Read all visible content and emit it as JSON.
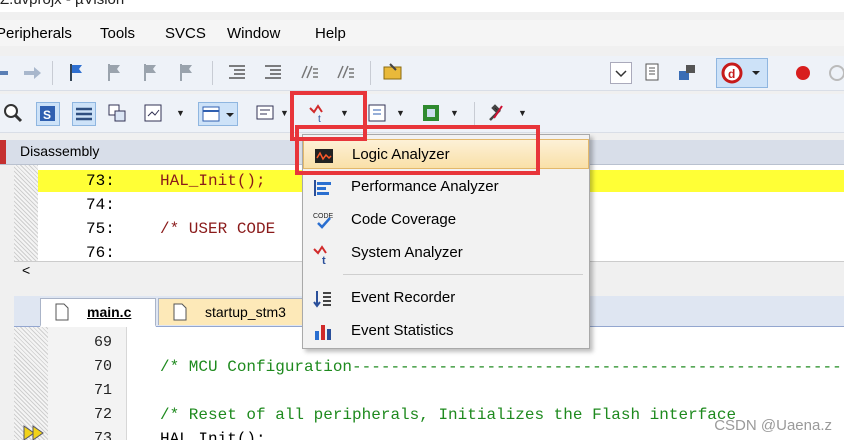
{
  "window": {
    "title": "Z.uvprojx - µVision"
  },
  "menubar": {
    "items": [
      "Peripherals",
      "Tools",
      "SVCS",
      "Window",
      "Help"
    ]
  },
  "disassembly": {
    "tab_label": "Disassembly",
    "lines": [
      {
        "num": "73:",
        "code": "HAL_Init();"
      },
      {
        "num": "74:",
        "code": ""
      },
      {
        "num": "75:",
        "code": "/* USER CODE"
      },
      {
        "num": "76:",
        "code": ""
      }
    ],
    "scroll_left_glyph": "<"
  },
  "editor": {
    "tabs": [
      {
        "label": "main.c",
        "active": true
      },
      {
        "label": "startup_stm3",
        "active": false
      }
    ],
    "lines": [
      {
        "num": "69",
        "code": ""
      },
      {
        "num": "70",
        "code": "/* MCU Configuration------------------------------------------------------------"
      },
      {
        "num": "71",
        "code": ""
      },
      {
        "num": "72",
        "code": "/* Reset of all peripherals, Initializes the Flash interface"
      },
      {
        "num": "73",
        "code": "HAL_Init();"
      }
    ]
  },
  "analysis_menu": {
    "items": [
      {
        "label": "Logic Analyzer",
        "icon": "logic-analyzer-icon",
        "highlighted": true
      },
      {
        "label": "Performance Analyzer",
        "icon": "performance-analyzer-icon"
      },
      {
        "label": "Code Coverage",
        "icon": "code-coverage-icon",
        "icon_text": "CODE"
      },
      {
        "label": "System Analyzer",
        "icon": "system-analyzer-icon"
      },
      {
        "label": "Event Recorder",
        "icon": "event-recorder-icon"
      },
      {
        "label": "Event Statistics",
        "icon": "event-statistics-icon"
      }
    ]
  },
  "watermark": "CSDN @Uaena.z",
  "colors": {
    "highlight_line": "#ffff36",
    "annotation_red": "#e8353a",
    "menu_hover": "#f9e0a8",
    "comment_green": "#1e8a1e"
  }
}
